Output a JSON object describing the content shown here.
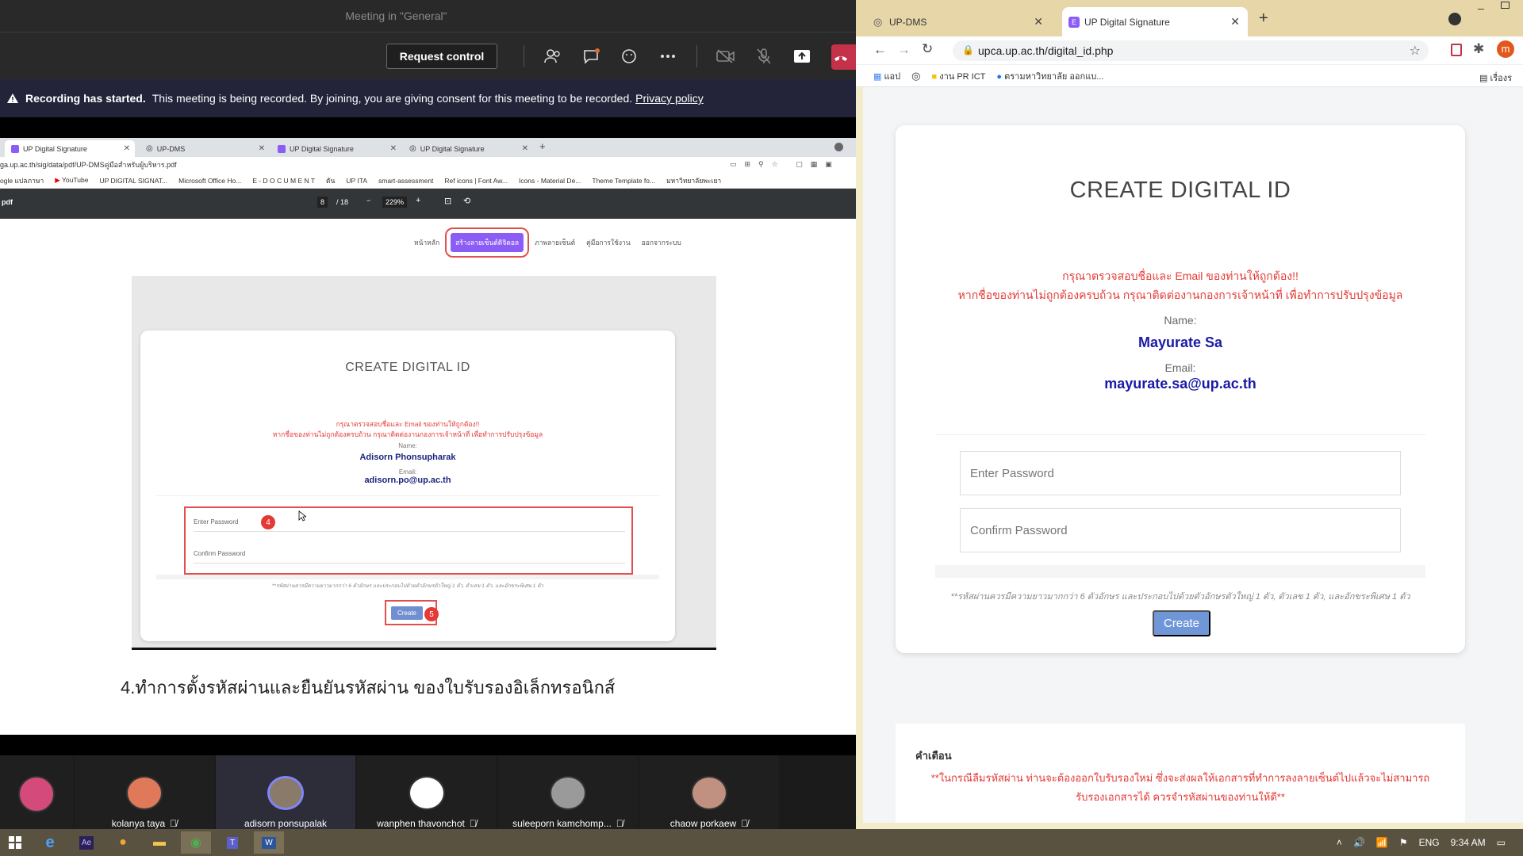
{
  "teams": {
    "title": "Meeting in \"General\"",
    "request_control": "Request control",
    "banner": {
      "bold": "Recording has started.",
      "text": "This meeting is being recorded. By joining, you are giving consent for this meeting to be recorded.",
      "link": "Privacy policy"
    },
    "icons": [
      "people-icon",
      "chat-icon",
      "reactions-icon",
      "more-icon",
      "camera-off-icon",
      "mic-off-icon",
      "share-icon",
      "hangup-icon"
    ]
  },
  "shared_screen": {
    "tabs": [
      "UP Digital Signature",
      "UP-DMS",
      "UP Digital Signature",
      "UP Digital Signature"
    ],
    "url": "ga.up.ac.th/sig/data/pdf/UP-DMSคู่มือสำหรับผู้บริหาร.pdf",
    "bookmarks": [
      "ogle แปลภาษา",
      "YouTube",
      "UP DIGITAL SIGNAT...",
      "Microsoft Office Ho...",
      "E - D O C U M E N T",
      "ตัน",
      "UP ITA",
      "smart-assessment",
      "Ref icons | Font Aw...",
      "Icons - Material De...",
      "Theme Template fo...",
      "มหาวิทยาลัยพะเยา"
    ],
    "pdf": {
      "name": "pdf",
      "page": "8",
      "total": "/ 18",
      "zoom": "229%"
    },
    "nav": [
      "หน้าหลัก",
      "สร้างลายเซ็นต์ดิจิตอล",
      "ภาพลายเซ็นต์",
      "คู่มือการใช้งาน",
      "ออกจากระบบ"
    ],
    "card": {
      "title": "CREATE DIGITAL ID",
      "warn1": "กรุณาตรวจสอบชื่อและ Email ของท่านให้ถูกต้อง!!",
      "warn2": "หากชื่อของท่านไม่ถูกต้องครบถ้วน กรุณาติดต่องานกองการเจ้าหน้าที่ เพื่อทำการปรับปรุงข้อมูล",
      "name_label": "Name:",
      "name": "Adisorn Phonsupharak",
      "email_label": "Email:",
      "email": "adisorn.po@up.ac.th",
      "password_placeholder": "Enter Password",
      "confirm_placeholder": "Confirm Password",
      "badge_password": "4",
      "badge_create": "5",
      "note": "**รหัสผ่านควรมีความยาวมากกว่า 6 ตัวอักษร และประกอบไปด้วยตัวอักษรตัวใหญ่ 1 ตัว, ตัวเลข 1 ตัว, และอักขระพิเศษ 1 ตัว",
      "create": "Create"
    },
    "caption": "4.ทำการตั้งรหัสผ่านและยืนยันรหัสผ่าน ของใบรับรองอิเล็กทรอนิกส์"
  },
  "gallery": [
    {
      "name": "",
      "muted": false,
      "avatar_color": "#d44a7a"
    },
    {
      "name": "kolanya taya",
      "muted": true,
      "avatar_color": "#e0785a"
    },
    {
      "name": "adisorn ponsupalak",
      "muted": false,
      "avatar_color": "#8a7a6a"
    },
    {
      "name": "wanphen thavonchot",
      "muted": true,
      "avatar_color": "#4a8fd0"
    },
    {
      "name": "suleeporn kamchomp...",
      "muted": true,
      "avatar_color": "#9a9a9a"
    },
    {
      "name": "chaow porkaew",
      "muted": true,
      "avatar_color": "#c09080"
    }
  ],
  "chrome": {
    "tabs": [
      {
        "label": "UP-DMS",
        "active": false
      },
      {
        "label": "UP Digital Signature",
        "active": true
      }
    ],
    "url": "upca.up.ac.th/digital_id.php",
    "profile_initial": "m",
    "bookmarks": [
      "แอป",
      "งาน PR ICT",
      "ตรามหาวิทยาลัย ออกแบ..."
    ],
    "reading_list": "เรื่องร"
  },
  "page": {
    "title": "CREATE DIGITAL ID",
    "warn1": "กรุณาตรวจสอบชื่อและ Email ของท่านให้ถูกต้อง!!",
    "warn2": "หากชื่อของท่านไม่ถูกต้องครบถ้วน กรุณาติดต่องานกองการเจ้าหน้าที่ เพื่อทำการปรับปรุงข้อมูล",
    "name_label": "Name:",
    "name": "Mayurate Sa",
    "email_label": "Email:",
    "email": "mayurate.sa@up.ac.th",
    "password_placeholder": "Enter Password",
    "confirm_placeholder": "Confirm Password",
    "note": "**รหัสผ่านควรมีความยาวมากกว่า 6 ตัวอักษร และประกอบไปด้วยตัวอักษรตัวใหญ่ 1 ตัว, ตัวเลข 1 ตัว, และอักขระพิเศษ 1 ตัว",
    "create": "Create",
    "warning_title": "คำเตือน",
    "warning_line1": "**ในกรณีลืมรหัสผ่าน ท่านจะต้องออกใบรับรองใหม่ ซึ่งจะส่งผลให้เอกสารที่ทำการลงลายเซ็นต์ไปแล้วจะไม่สามารถ",
    "warning_line2": "รับรองเอกสารได้ ควรจำรหัสผ่านของท่านให้ดี**"
  },
  "taskbar": {
    "lang": "ENG",
    "time": "9:34 AM",
    "apps": [
      "windows-start-icon",
      "ie-icon",
      "after-effects-icon",
      "paint-icon",
      "file-explorer-icon",
      "chrome-icon",
      "teams-icon",
      "word-icon"
    ]
  },
  "colors": {
    "teams_bg": "#292929",
    "hangup": "#c4314b",
    "brand_purple": "#8b5cf6",
    "warn_red": "#e53935",
    "name_blue": "#1a1aa6",
    "create_btn": "#6f97d8"
  }
}
